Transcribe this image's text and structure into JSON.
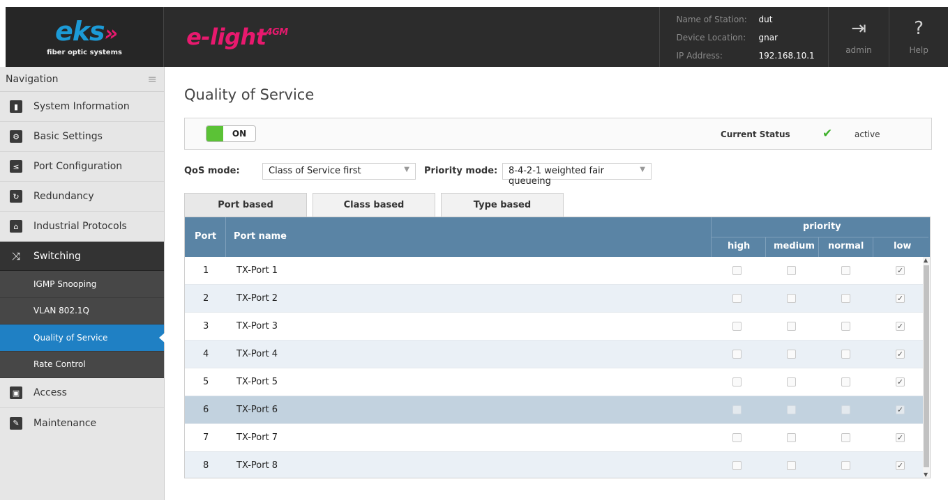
{
  "brand": {
    "logo_text": "eks",
    "logo_arrows": "»",
    "logo_sub": "fiber optic systems",
    "product": "e-light",
    "product_sup": "4GM"
  },
  "station": {
    "name_label": "Name of Station:",
    "name_value": "dut",
    "location_label": "Device Location:",
    "location_value": "gnar",
    "ip_label": "IP Address:",
    "ip_value": "192.168.10.1"
  },
  "header_buttons": {
    "logout_label": "admin",
    "help_label": "Help"
  },
  "nav": {
    "heading": "Navigation",
    "items": [
      {
        "label": "System Information",
        "icon": "bar-chart-icon"
      },
      {
        "label": "Basic Settings",
        "icon": "gear-icon"
      },
      {
        "label": "Port Configuration",
        "icon": "port-icon"
      },
      {
        "label": "Redundancy",
        "icon": "redundancy-icon"
      },
      {
        "label": "Industrial Protocols",
        "icon": "factory-icon"
      },
      {
        "label": "Switching",
        "icon": "shuffle-icon"
      },
      {
        "label": "Access",
        "icon": "lock-icon"
      },
      {
        "label": "Maintenance",
        "icon": "wrench-icon"
      }
    ],
    "sub_items": [
      "IGMP Snooping",
      "VLAN 802.1Q",
      "Quality of Service",
      "Rate Control"
    ],
    "active_sub": "Quality of Service"
  },
  "page": {
    "title": "Quality of Service",
    "toggle_label": "ON",
    "current_status_label": "Current Status",
    "current_status_value": "active",
    "qos_mode_label": "QoS mode:",
    "qos_mode_value": "Class of Service first",
    "priority_mode_label": "Priority mode:",
    "priority_mode_value": "8-4-2-1 weighted fair queueing",
    "tabs": [
      "Port based",
      "Class based",
      "Type based"
    ],
    "active_tab": "Port based"
  },
  "table": {
    "col_port": "Port",
    "col_name": "Port name",
    "col_priority": "priority",
    "priority_cols": [
      "high",
      "medium",
      "normal",
      "low"
    ],
    "rows": [
      {
        "port": "1",
        "name": "TX-Port 1",
        "checked": "low"
      },
      {
        "port": "2",
        "name": "TX-Port 2",
        "checked": "low"
      },
      {
        "port": "3",
        "name": "TX-Port 3",
        "checked": "low"
      },
      {
        "port": "4",
        "name": "TX-Port 4",
        "checked": "low"
      },
      {
        "port": "5",
        "name": "TX-Port 5",
        "checked": "low"
      },
      {
        "port": "6",
        "name": "TX-Port 6",
        "checked": "low"
      },
      {
        "port": "7",
        "name": "TX-Port 7",
        "checked": "low"
      },
      {
        "port": "8",
        "name": "TX-Port 8",
        "checked": "low"
      }
    ]
  },
  "colors": {
    "accent_blue": "#1f80c4",
    "brand_pink": "#e8196e",
    "table_header": "#5a84a5",
    "status_green": "#3db02a"
  }
}
